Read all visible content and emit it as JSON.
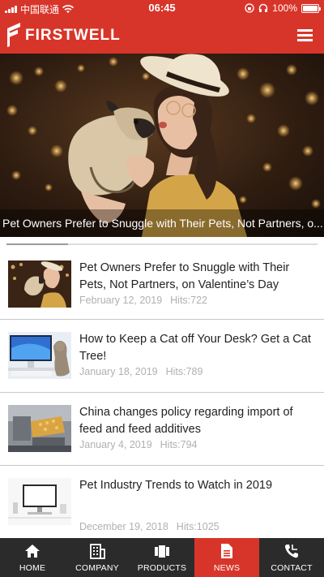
{
  "status_bar": {
    "carrier": "中国联通",
    "time": "06:45",
    "battery": "100%"
  },
  "header": {
    "brand": "FIRSTWELL",
    "menu_icon": "hamburger-menu-icon"
  },
  "hero": {
    "caption": "Pet Owners Prefer to Snuggle with Their Pets, Not Partners, o..."
  },
  "news": {
    "items": [
      {
        "title": "Pet Owners Prefer to Snuggle with Their Pets, Not Partners, on Valentine’s Day",
        "date": "February 12, 2019",
        "hits": "Hits:722"
      },
      {
        "title": "How to Keep a Cat off Your Desk? Get a Cat Tree!",
        "date": "January 18, 2019",
        "hits": "Hits:789"
      },
      {
        "title": "China changes policy regarding import of feed and feed additives",
        "date": "January 4, 2019",
        "hits": "Hits:794"
      },
      {
        "title": "Pet Industry Trends to Watch in 2019",
        "date": "December 19, 2018",
        "hits": "Hits:1025"
      }
    ]
  },
  "nav": {
    "items": [
      {
        "label": "HOME",
        "icon": "home-icon"
      },
      {
        "label": "COMPANY",
        "icon": "building-icon"
      },
      {
        "label": "PRODUCTS",
        "icon": "products-icon"
      },
      {
        "label": "NEWS",
        "icon": "document-icon",
        "active": true
      },
      {
        "label": "CONTACT",
        "icon": "phone-icon"
      }
    ]
  },
  "colors": {
    "brand_red": "#d8352a",
    "nav_dark": "#2b2b2b",
    "meta_gray": "#b0b0b0"
  }
}
